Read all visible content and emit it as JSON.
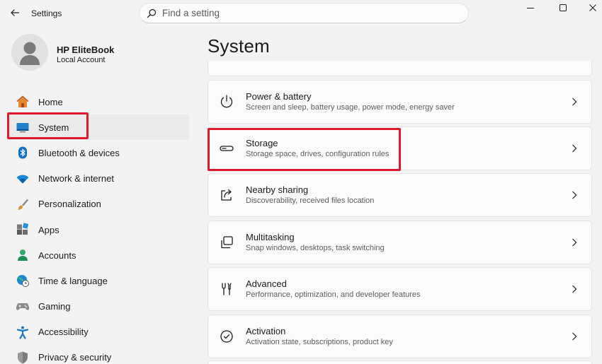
{
  "window": {
    "title": "Settings",
    "controls": [
      "minimize-icon",
      "maximize-icon",
      "close-icon"
    ]
  },
  "search": {
    "placeholder": "Find a setting"
  },
  "profile": {
    "name": "HP EliteBook",
    "account_type": "Local Account"
  },
  "sidebar": {
    "items": [
      {
        "label": "Home",
        "icon": "home-icon"
      },
      {
        "label": "System",
        "icon": "system-icon",
        "selected": true
      },
      {
        "label": "Bluetooth & devices",
        "icon": "bluetooth-icon"
      },
      {
        "label": "Network & internet",
        "icon": "wifi-icon"
      },
      {
        "label": "Personalization",
        "icon": "brush-icon"
      },
      {
        "label": "Apps",
        "icon": "apps-icon"
      },
      {
        "label": "Accounts",
        "icon": "accounts-icon"
      },
      {
        "label": "Time & language",
        "icon": "globe-clock-icon"
      },
      {
        "label": "Gaming",
        "icon": "gamepad-icon"
      },
      {
        "label": "Accessibility",
        "icon": "accessibility-icon"
      },
      {
        "label": "Privacy & security",
        "icon": "shield-icon"
      }
    ]
  },
  "main": {
    "title": "System",
    "cards": [
      {
        "title": "Power & battery",
        "subtitle": "Screen and sleep, battery usage, power mode, energy saver",
        "icon": "power-icon"
      },
      {
        "title": "Storage",
        "subtitle": "Storage space, drives, configuration rules",
        "icon": "storage-icon",
        "highlighted": true
      },
      {
        "title": "Nearby sharing",
        "subtitle": "Discoverability, received files location",
        "icon": "share-icon"
      },
      {
        "title": "Multitasking",
        "subtitle": "Snap windows, desktops, task switching",
        "icon": "multitask-icon"
      },
      {
        "title": "Advanced",
        "subtitle": "Performance, optimization, and developer features",
        "icon": "tools-icon"
      },
      {
        "title": "Activation",
        "subtitle": "Activation state, subscriptions, product key",
        "icon": "check-circle-icon"
      }
    ]
  },
  "colors": {
    "accent": "#0067c0",
    "highlight": "#e0182d",
    "background": "#f3f3f3",
    "card": "#fbfbfb"
  }
}
